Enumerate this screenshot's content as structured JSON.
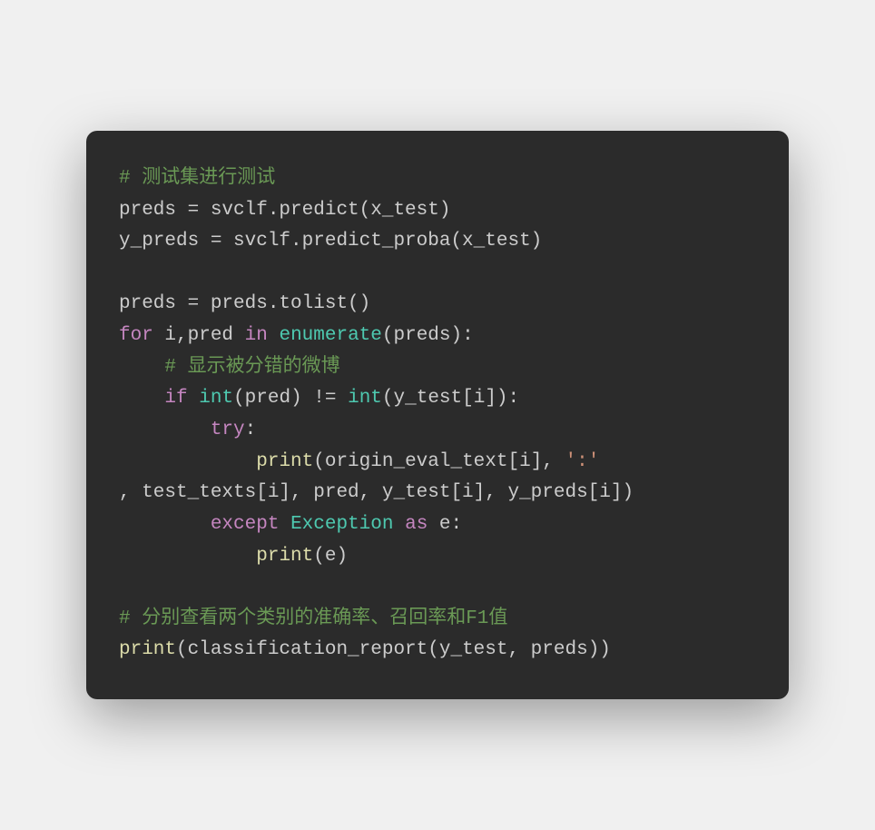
{
  "code": {
    "tokens": [
      {
        "text": "# 测试集进行测试",
        "class": "comment"
      },
      {
        "text": "\n",
        "class": "default"
      },
      {
        "text": "preds = svclf.predict(x_test)",
        "class": "default"
      },
      {
        "text": "\n",
        "class": "default"
      },
      {
        "text": "y_preds = svclf.predict_proba(x_test)",
        "class": "default"
      },
      {
        "text": "\n\n",
        "class": "default"
      },
      {
        "text": "preds = preds.tolist()",
        "class": "default"
      },
      {
        "text": "\n",
        "class": "default"
      },
      {
        "text": "for",
        "class": "keyword"
      },
      {
        "text": " i,pred ",
        "class": "default"
      },
      {
        "text": "in",
        "class": "keyword"
      },
      {
        "text": " ",
        "class": "default"
      },
      {
        "text": "enumerate",
        "class": "builtin"
      },
      {
        "text": "(preds):",
        "class": "default"
      },
      {
        "text": "\n    ",
        "class": "default"
      },
      {
        "text": "# 显示被分错的微博",
        "class": "comment"
      },
      {
        "text": "\n    ",
        "class": "default"
      },
      {
        "text": "if",
        "class": "keyword"
      },
      {
        "text": " ",
        "class": "default"
      },
      {
        "text": "int",
        "class": "builtin"
      },
      {
        "text": "(pred) != ",
        "class": "default"
      },
      {
        "text": "int",
        "class": "builtin"
      },
      {
        "text": "(y_test[i]):",
        "class": "default"
      },
      {
        "text": "\n        ",
        "class": "default"
      },
      {
        "text": "try",
        "class": "keyword"
      },
      {
        "text": ":",
        "class": "default"
      },
      {
        "text": "\n            ",
        "class": "default"
      },
      {
        "text": "print",
        "class": "function"
      },
      {
        "text": "(origin_eval_text[i], ",
        "class": "default"
      },
      {
        "text": "':'",
        "class": "string"
      },
      {
        "text": "\n, test_texts[i], pred, y_test[i], y_preds[i])",
        "class": "default"
      },
      {
        "text": "\n        ",
        "class": "default"
      },
      {
        "text": "except",
        "class": "keyword"
      },
      {
        "text": " ",
        "class": "default"
      },
      {
        "text": "Exception",
        "class": "builtin"
      },
      {
        "text": " ",
        "class": "default"
      },
      {
        "text": "as",
        "class": "keyword"
      },
      {
        "text": " e:",
        "class": "default"
      },
      {
        "text": "\n            ",
        "class": "default"
      },
      {
        "text": "print",
        "class": "function"
      },
      {
        "text": "(e)",
        "class": "default"
      },
      {
        "text": "\n\n",
        "class": "default"
      },
      {
        "text": "# 分别查看两个类别的准确率、召回率和F1值",
        "class": "comment"
      },
      {
        "text": "\n",
        "class": "default"
      },
      {
        "text": "print",
        "class": "function"
      },
      {
        "text": "(classification_report(y_test, preds))",
        "class": "default"
      }
    ]
  }
}
